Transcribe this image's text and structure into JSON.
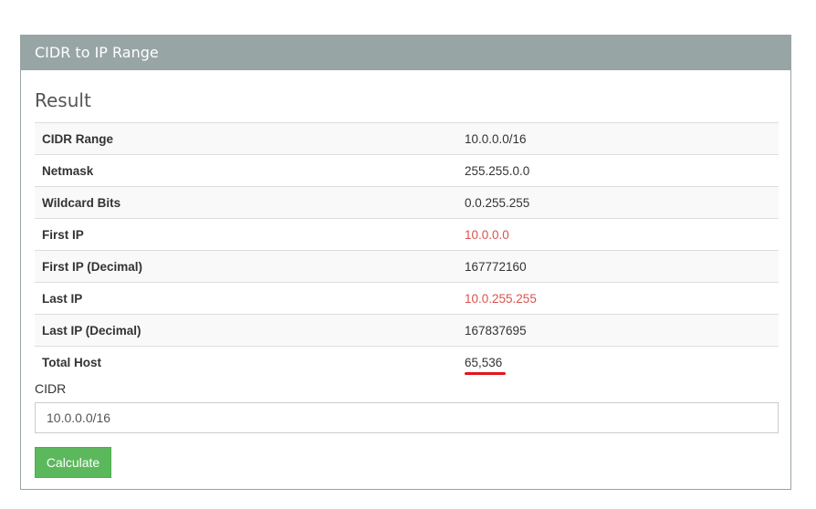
{
  "panel": {
    "title": "CIDR to IP Range"
  },
  "result": {
    "heading": "Result",
    "rows": [
      {
        "label": "CIDR Range",
        "value": "10.0.0.0/16"
      },
      {
        "label": "Netmask",
        "value": "255.255.0.0"
      },
      {
        "label": "Wildcard Bits",
        "value": "0.0.255.255"
      },
      {
        "label": "First IP",
        "value": "10.0.0.0"
      },
      {
        "label": "First IP (Decimal)",
        "value": "167772160"
      },
      {
        "label": "Last IP",
        "value": "10.0.255.255"
      },
      {
        "label": "Last IP (Decimal)",
        "value": "167837695"
      },
      {
        "label": "Total Host",
        "value": "65,536"
      }
    ]
  },
  "form": {
    "cidr_label": "CIDR",
    "cidr_value": "10.0.0.0/16",
    "calculate_label": "Calculate"
  },
  "colors": {
    "header_bg": "#97a5a4",
    "highlight_ip": "#d9534f",
    "button_green": "#5cb85c",
    "annotation_underline": "#e4141c"
  }
}
